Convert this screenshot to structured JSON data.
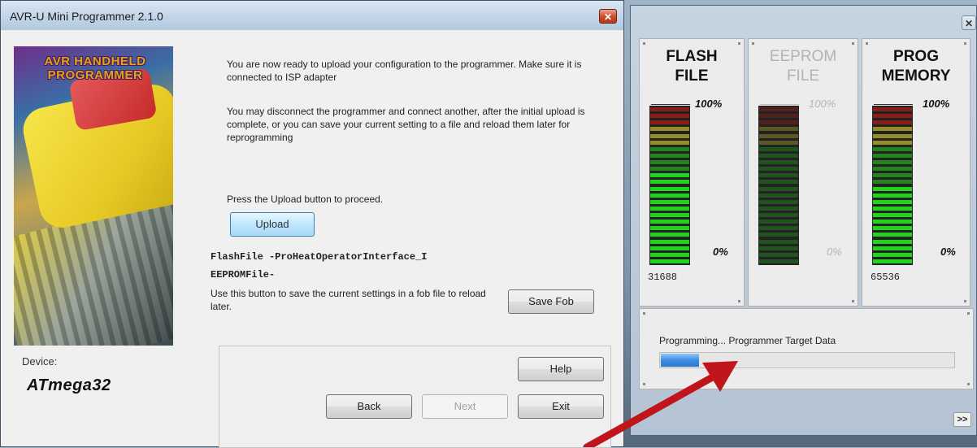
{
  "main_window": {
    "title": "AVR-U Mini Programmer 2.1.0",
    "close_label": "✕",
    "image_caption": "AVR HANDHELD PROGRAMMER",
    "paragraph1": "You are now ready to upload your configuration to the programmer. Make sure it is connected to ISP adapter",
    "paragraph2": "You may disconnect the programmer and connect another, after the initial upload is complete, or you can save your current setting to a file and reload them later for reprogramming",
    "press_text": "Press the Upload button to proceed.",
    "upload_label": "Upload",
    "flash_file_line": "FlashFile -ProHeatOperatorInterface_I",
    "eeprom_file_line": "EEPROMFile-",
    "save_text": "Use this button to save the current settings in a fob file to reload later.",
    "save_fob_label": "Save Fob",
    "device_label": "Device:",
    "device_value": "ATmega32",
    "help_label": "Help",
    "back_label": "Back",
    "next_label": "Next",
    "exit_label": "Exit"
  },
  "secondary_window": {
    "close_label": "✕",
    "meters": [
      {
        "title_line1": "FLASH",
        "title_line2": "FILE",
        "max_label": "100%",
        "min_label": "0%",
        "count": "31688",
        "active": true,
        "fill_fraction": 0.58
      },
      {
        "title_line1": "EEPROM",
        "title_line2": "FILE",
        "max_label": "100%",
        "min_label": "0%",
        "count": "",
        "active": false,
        "fill_fraction": 0
      },
      {
        "title_line1": "PROG",
        "title_line2": "MEMORY",
        "max_label": "100%",
        "min_label": "0%",
        "count": "65536",
        "active": true,
        "fill_fraction": 0.48
      }
    ],
    "progress_label": "Programming... Programmer Target Data",
    "progress_fraction": 0.13,
    "expand_label": ">>"
  },
  "colors": {
    "arrow": "#c0151a",
    "seg_green": "#22d41e",
    "seg_yellow": "#f2e631",
    "seg_red": "#d81d14"
  }
}
